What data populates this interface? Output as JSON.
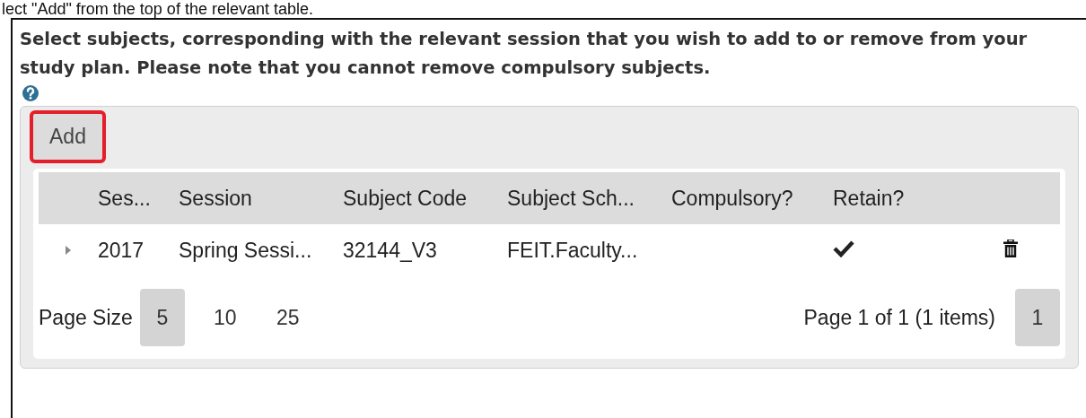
{
  "caption": "lect \"Add\" from the top of the relevant table.",
  "instructions": "Select subjects, corresponding with the relevant session that you wish to add to or remove from your study plan. Please note that you cannot remove compulsory subjects.",
  "toolbar": {
    "add_button": "Add",
    "highlighted": true
  },
  "table": {
    "columns": [
      "Ses...",
      "Session",
      "Subject Code",
      "Subject Sch...",
      "Compulsory?",
      "Retain?"
    ],
    "rows": [
      {
        "expanded": false,
        "cells": [
          "2017",
          "Spring Sessi...",
          "32144_V3",
          "FEIT.Faculty..."
        ],
        "retain": true
      }
    ]
  },
  "pager": {
    "page_size_label": "Page Size",
    "page_sizes": [
      {
        "label": "5",
        "selected": true
      },
      {
        "label": "10",
        "selected": false
      },
      {
        "label": "25",
        "selected": false
      }
    ],
    "summary": "Page 1 of 1 (1 items)",
    "pages": [
      {
        "label": "1",
        "selected": true
      }
    ]
  }
}
